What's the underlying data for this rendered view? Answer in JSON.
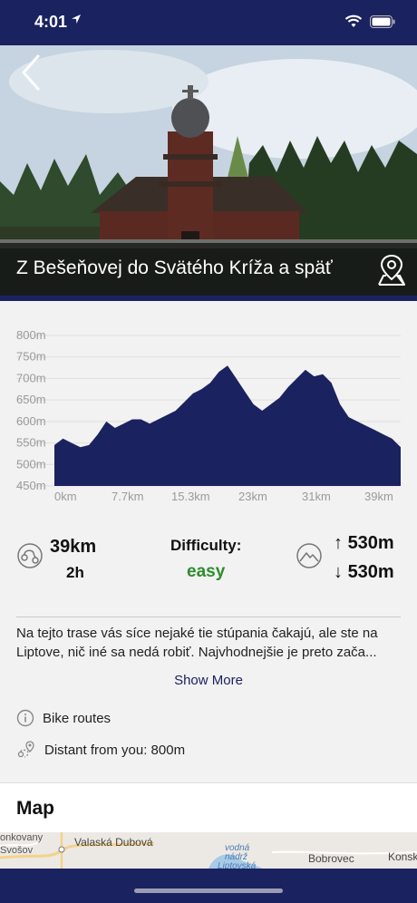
{
  "status_bar": {
    "time": "4:01"
  },
  "hero": {
    "title": "Z Bešeňovej do Svätého Kríža a späť"
  },
  "chart_data": {
    "type": "area",
    "y_ticks": [
      "800m",
      "750m",
      "700m",
      "650m",
      "600m",
      "550m",
      "500m",
      "450m"
    ],
    "x_ticks": [
      "0km",
      "7.7km",
      "15.3km",
      "23km",
      "31km",
      "39km"
    ],
    "ylim": [
      450,
      800
    ],
    "xlim": [
      0,
      40
    ],
    "x": [
      0,
      1,
      2,
      3,
      4,
      5,
      6,
      7,
      8,
      9,
      10,
      11,
      12,
      13,
      14,
      15,
      16,
      17,
      18,
      19,
      20,
      21,
      22,
      23,
      24,
      25,
      26,
      27,
      28,
      29,
      30,
      31,
      32,
      33,
      34,
      35,
      36,
      37,
      38,
      39,
      40
    ],
    "y": [
      545,
      560,
      550,
      540,
      545,
      570,
      600,
      585,
      595,
      605,
      605,
      595,
      605,
      615,
      625,
      645,
      665,
      675,
      690,
      715,
      730,
      700,
      670,
      640,
      625,
      640,
      655,
      680,
      700,
      720,
      705,
      710,
      690,
      640,
      610,
      600,
      590,
      580,
      570,
      560,
      540
    ],
    "fill_color": "#1b2260",
    "grid": true
  },
  "stats": {
    "distance": "39km",
    "duration": "2h",
    "difficulty_label": "Difficulty:",
    "difficulty_value": "easy",
    "ascent": "530m",
    "descent": "530m"
  },
  "description": {
    "line1": "Na tejto trase vás síce nejaké tie stúpania čakajú, ale ste na",
    "line2": "Liptove, nič iné sa nedá robiť. Najvhodnejšie je preto zača...",
    "show_more": "Show More"
  },
  "info": {
    "category": "Bike routes",
    "distance_from_you": "Distant from you: 800m"
  },
  "map": {
    "title": "Map",
    "labels": [
      "onkovany",
      "Svošov",
      "Valaská Dubová",
      "vodná",
      "nádrž",
      "Liptovská",
      "Bobrovec",
      "Konsk"
    ]
  },
  "colors": {
    "brand": "#1b2260",
    "difficulty_easy": "#2e8b2e"
  }
}
